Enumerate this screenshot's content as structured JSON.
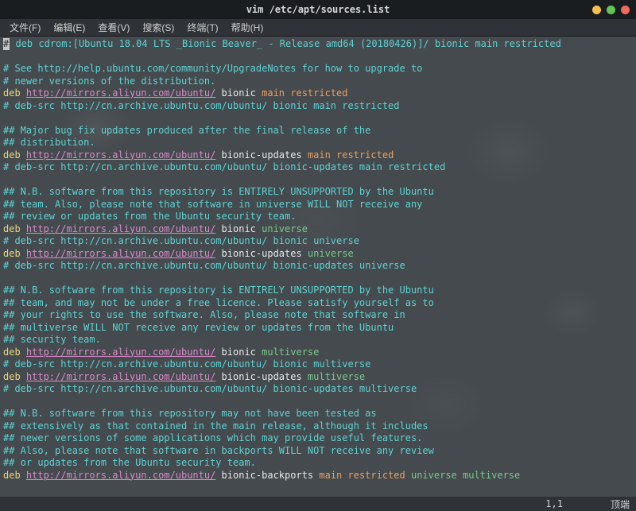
{
  "window": {
    "title": "vim /etc/apt/sources.list"
  },
  "menu": {
    "file": "文件(F)",
    "edit": "编辑(E)",
    "view": "查看(V)",
    "search": "搜索(S)",
    "terminal": "终端(T)",
    "help": "帮助(H)"
  },
  "lines": [
    {
      "segs": [
        {
          "t": "# ",
          "cls": "c-comment"
        },
        {
          "t": "deb cdrom:[Ubuntu 18.04 LTS _Bionic Beaver_ - Release amd64 (20180426)]/ bionic main restricted",
          "cls": "c-comment"
        }
      ],
      "cursor": true
    },
    {
      "segs": []
    },
    {
      "segs": [
        {
          "t": "# See http://help.ubuntu.com/community/UpgradeNotes for how to upgrade to",
          "cls": "c-comment"
        }
      ]
    },
    {
      "segs": [
        {
          "t": "# newer versions of the distribution.",
          "cls": "c-comment"
        }
      ]
    },
    {
      "segs": [
        {
          "t": "deb ",
          "cls": "c-keyword"
        },
        {
          "t": "http://mirrors.aliyun.com/ubuntu/",
          "cls": "c-url"
        },
        {
          "t": " bionic ",
          "cls": "c-white"
        },
        {
          "t": "main restricted",
          "cls": "c-orange"
        }
      ]
    },
    {
      "segs": [
        {
          "t": "# deb-src http://cn.archive.ubuntu.com/ubuntu/ bionic main restricted",
          "cls": "c-comment"
        }
      ]
    },
    {
      "segs": []
    },
    {
      "segs": [
        {
          "t": "## Major bug fix updates produced after the final release of the",
          "cls": "c-comment"
        }
      ]
    },
    {
      "segs": [
        {
          "t": "## distribution.",
          "cls": "c-comment"
        }
      ]
    },
    {
      "segs": [
        {
          "t": "deb ",
          "cls": "c-keyword"
        },
        {
          "t": "http://mirrors.aliyun.com/ubuntu/",
          "cls": "c-url"
        },
        {
          "t": " bionic-updates ",
          "cls": "c-white"
        },
        {
          "t": "main restricted",
          "cls": "c-orange"
        }
      ]
    },
    {
      "segs": [
        {
          "t": "# deb-src http://cn.archive.ubuntu.com/ubuntu/ bionic-updates main restricted",
          "cls": "c-comment"
        }
      ]
    },
    {
      "segs": []
    },
    {
      "segs": [
        {
          "t": "## N.B. software from this repository is ENTIRELY UNSUPPORTED by the Ubuntu",
          "cls": "c-comment"
        }
      ]
    },
    {
      "segs": [
        {
          "t": "## team. Also, please note that software in universe WILL NOT receive any",
          "cls": "c-comment"
        }
      ]
    },
    {
      "segs": [
        {
          "t": "## review or updates from the Ubuntu security team.",
          "cls": "c-comment"
        }
      ]
    },
    {
      "segs": [
        {
          "t": "deb ",
          "cls": "c-keyword"
        },
        {
          "t": "http://mirrors.aliyun.com/ubuntu/",
          "cls": "c-url"
        },
        {
          "t": " bionic ",
          "cls": "c-white"
        },
        {
          "t": "universe",
          "cls": "c-green"
        }
      ]
    },
    {
      "segs": [
        {
          "t": "# deb-src http://cn.archive.ubuntu.com/ubuntu/ bionic universe",
          "cls": "c-comment"
        }
      ]
    },
    {
      "segs": [
        {
          "t": "deb ",
          "cls": "c-keyword"
        },
        {
          "t": "http://mirrors.aliyun.com/ubuntu/",
          "cls": "c-url"
        },
        {
          "t": " bionic-updates ",
          "cls": "c-white"
        },
        {
          "t": "universe",
          "cls": "c-green"
        }
      ]
    },
    {
      "segs": [
        {
          "t": "# deb-src http://cn.archive.ubuntu.com/ubuntu/ bionic-updates universe",
          "cls": "c-comment"
        }
      ]
    },
    {
      "segs": []
    },
    {
      "segs": [
        {
          "t": "## N.B. software from this repository is ENTIRELY UNSUPPORTED by the Ubuntu",
          "cls": "c-comment"
        }
      ]
    },
    {
      "segs": [
        {
          "t": "## team, and may not be under a free licence. Please satisfy yourself as to",
          "cls": "c-comment"
        }
      ]
    },
    {
      "segs": [
        {
          "t": "## your rights to use the software. Also, please note that software in",
          "cls": "c-comment"
        }
      ]
    },
    {
      "segs": [
        {
          "t": "## multiverse WILL NOT receive any review or updates from the Ubuntu",
          "cls": "c-comment"
        }
      ]
    },
    {
      "segs": [
        {
          "t": "## security team.",
          "cls": "c-comment"
        }
      ]
    },
    {
      "segs": [
        {
          "t": "deb ",
          "cls": "c-keyword"
        },
        {
          "t": "http://mirrors.aliyun.com/ubuntu/",
          "cls": "c-url"
        },
        {
          "t": " bionic ",
          "cls": "c-white"
        },
        {
          "t": "multiverse",
          "cls": "c-green"
        }
      ]
    },
    {
      "segs": [
        {
          "t": "# deb-src http://cn.archive.ubuntu.com/ubuntu/ bionic multiverse",
          "cls": "c-comment"
        }
      ]
    },
    {
      "segs": [
        {
          "t": "deb ",
          "cls": "c-keyword"
        },
        {
          "t": "http://mirrors.aliyun.com/ubuntu/",
          "cls": "c-url"
        },
        {
          "t": " bionic-updates ",
          "cls": "c-white"
        },
        {
          "t": "multiverse",
          "cls": "c-green"
        }
      ]
    },
    {
      "segs": [
        {
          "t": "# deb-src http://cn.archive.ubuntu.com/ubuntu/ bionic-updates multiverse",
          "cls": "c-comment"
        }
      ]
    },
    {
      "segs": []
    },
    {
      "segs": [
        {
          "t": "## N.B. software from this repository may not have been tested as",
          "cls": "c-comment"
        }
      ]
    },
    {
      "segs": [
        {
          "t": "## extensively as that contained in the main release, although it includes",
          "cls": "c-comment"
        }
      ]
    },
    {
      "segs": [
        {
          "t": "## newer versions of some applications which may provide useful features.",
          "cls": "c-comment"
        }
      ]
    },
    {
      "segs": [
        {
          "t": "## Also, please note that software in backports WILL NOT receive any review",
          "cls": "c-comment"
        }
      ]
    },
    {
      "segs": [
        {
          "t": "## or updates from the Ubuntu security team.",
          "cls": "c-comment"
        }
      ]
    },
    {
      "segs": [
        {
          "t": "deb ",
          "cls": "c-keyword"
        },
        {
          "t": "http://mirrors.aliyun.com/ubuntu/",
          "cls": "c-url"
        },
        {
          "t": " bionic-backports ",
          "cls": "c-white"
        },
        {
          "t": "main restricted",
          "cls": "c-orange"
        },
        {
          "t": " ",
          "cls": "c-white"
        },
        {
          "t": "universe multiverse",
          "cls": "c-green"
        }
      ]
    }
  ],
  "status": {
    "pos": "1,1",
    "scroll": "顶端"
  }
}
